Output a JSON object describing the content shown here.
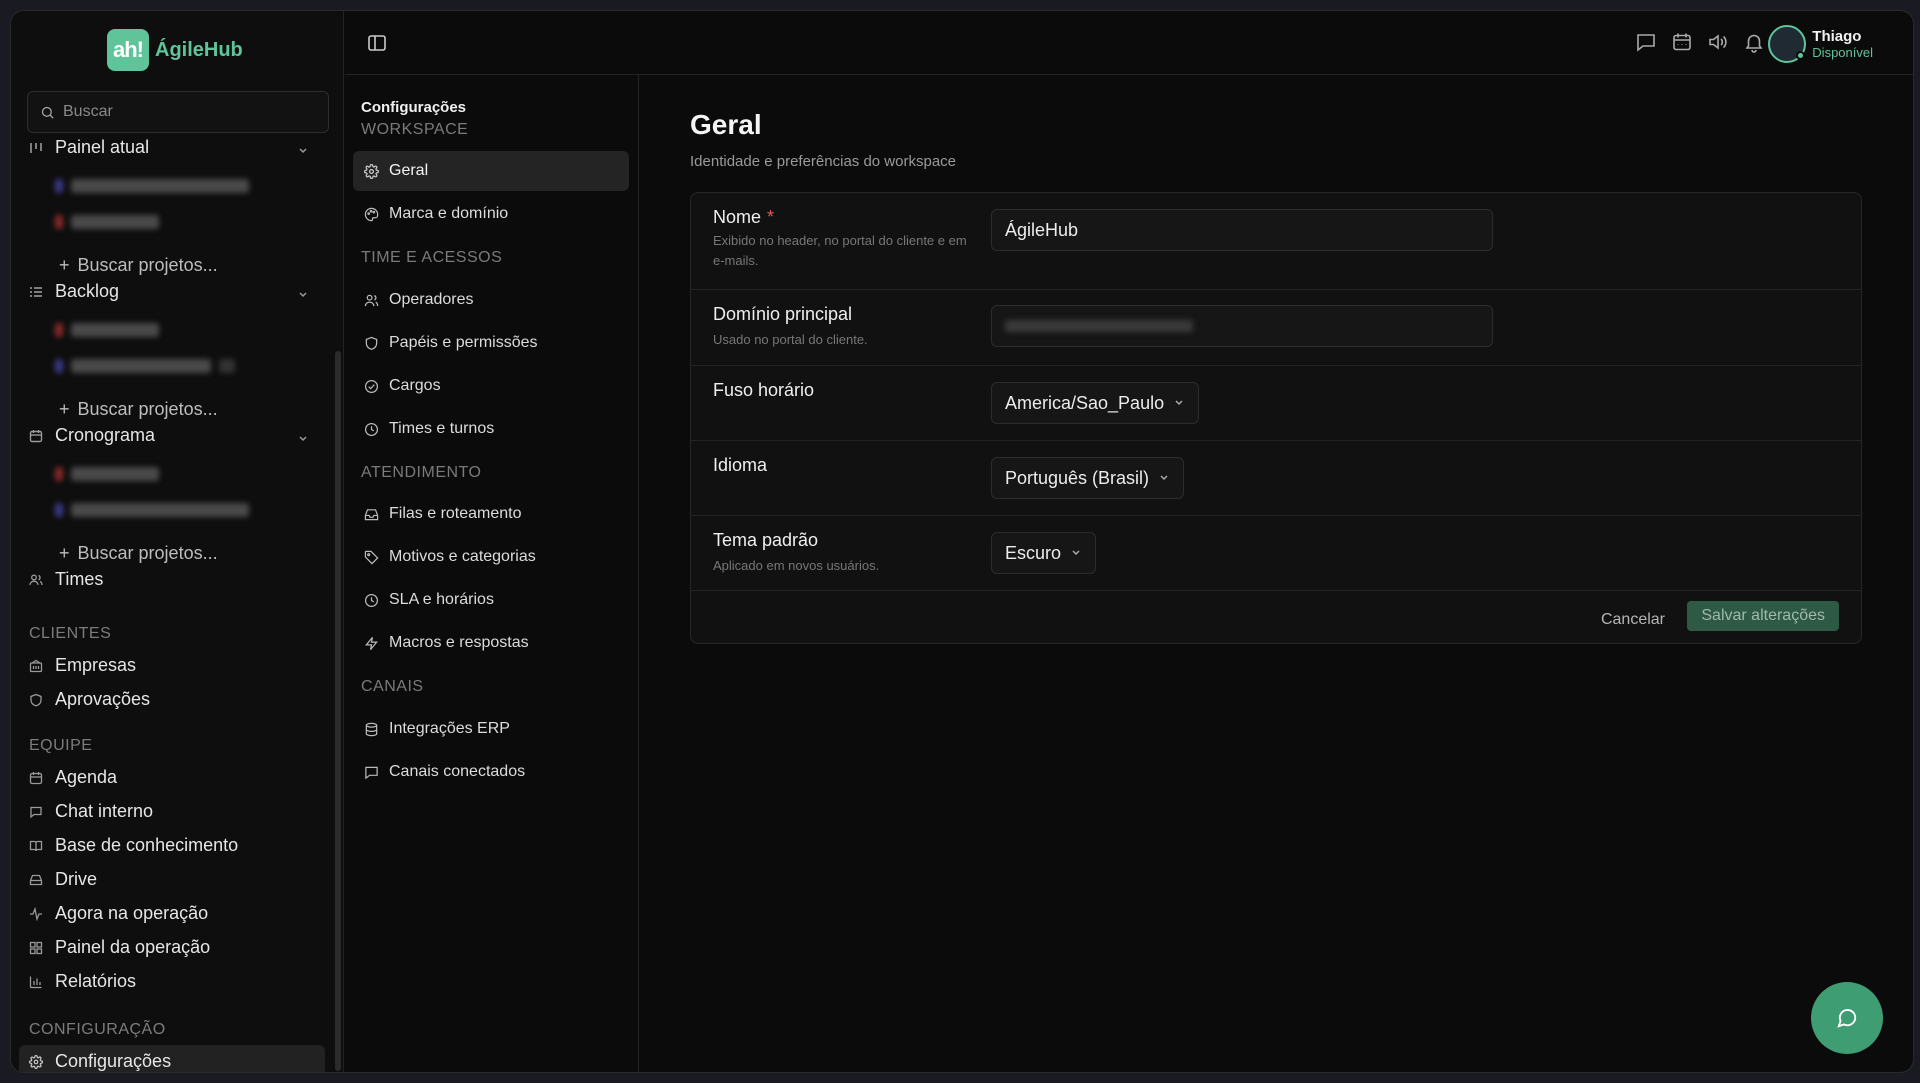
{
  "brand": {
    "logo_mark": "ah!",
    "name": "ÁgileHub",
    "accent": "#5fc49a"
  },
  "search": {
    "placeholder": "Buscar"
  },
  "sidebar": {
    "groups": [
      {
        "label": "Painel atual",
        "add_label": "Buscar projetos..."
      },
      {
        "label": "Backlog",
        "add_label": "Buscar projetos..."
      },
      {
        "label": "Cronograma",
        "add_label": "Buscar projetos..."
      }
    ],
    "times": "Times",
    "sections": {
      "clientes": "CLIENTES",
      "equipe": "EQUIPE",
      "configuracao": "CONFIGURAÇÃO"
    },
    "clientes_items": [
      "Empresas",
      "Aprovações"
    ],
    "equipe_items": [
      "Agenda",
      "Chat interno",
      "Base de conhecimento",
      "Drive",
      "Agora na operação",
      "Painel da operação",
      "Relatórios"
    ],
    "config_items": [
      "Configurações"
    ]
  },
  "settings_nav": {
    "title": "Configurações",
    "sections": [
      {
        "title": "WORKSPACE",
        "items": [
          "Geral",
          "Marca e domínio"
        ]
      },
      {
        "title": "TIME E ACESSOS",
        "items": [
          "Operadores",
          "Papéis e permissões",
          "Cargos",
          "Times e turnos"
        ]
      },
      {
        "title": "ATENDIMENTO",
        "items": [
          "Filas e roteamento",
          "Motivos e categorias",
          "SLA e horários",
          "Macros e respostas"
        ]
      },
      {
        "title": "CANAIS",
        "items": [
          "Integrações ERP",
          "Canais conectados"
        ]
      }
    ]
  },
  "user": {
    "name": "Thiago",
    "status": "Disponível"
  },
  "main": {
    "title": "Geral",
    "subtitle": "Identidade e preferências do workspace",
    "fields": {
      "nome": {
        "label": "Nome",
        "required": "*",
        "help": "Exibido no header, no portal do cliente e em e-mails.",
        "value": "ÁgileHub"
      },
      "dominio": {
        "label": "Domínio principal",
        "help": "Usado no portal do cliente."
      },
      "fuso": {
        "label": "Fuso horário",
        "value": "America/Sao_Paulo"
      },
      "idioma": {
        "label": "Idioma",
        "value": "Português (Brasil)"
      },
      "tema": {
        "label": "Tema padrão",
        "help": "Aplicado em novos usuários.",
        "value": "Escuro"
      }
    },
    "cancel": "Cancelar",
    "save": "Salvar alterações"
  }
}
